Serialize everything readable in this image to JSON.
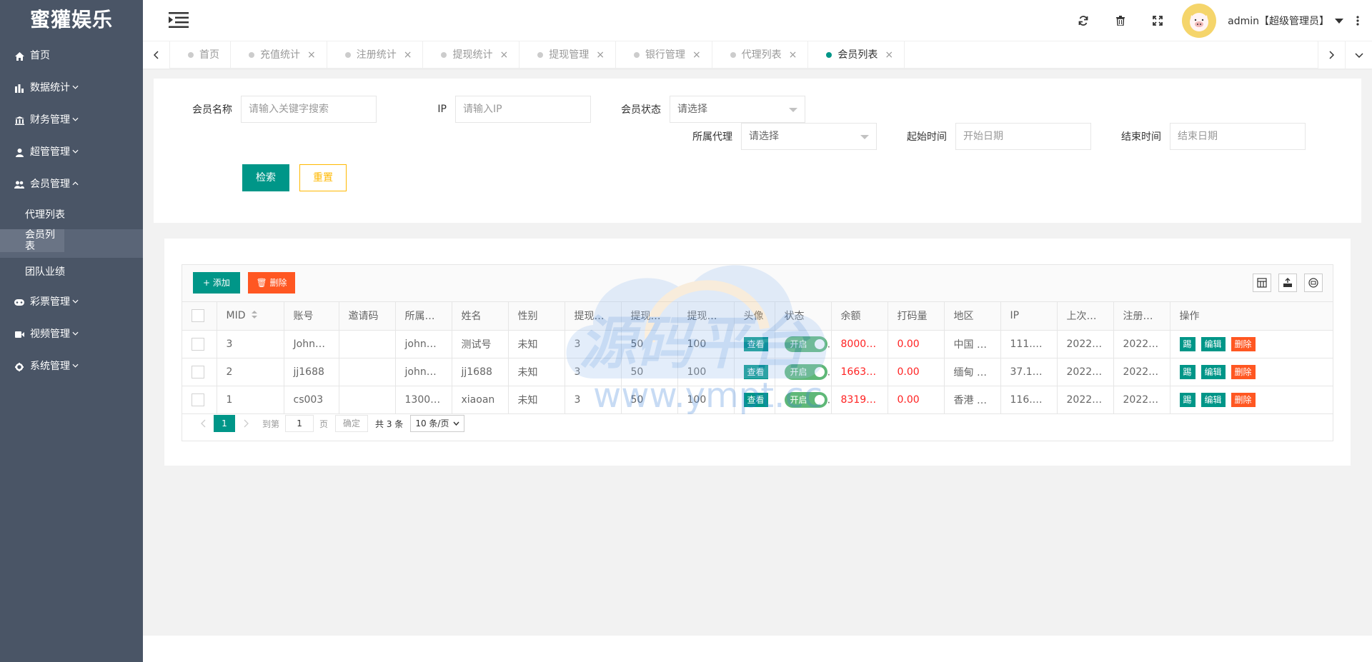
{
  "app": {
    "logo": "蜜獾娱乐"
  },
  "sidebar": {
    "items": [
      {
        "label": "首页",
        "icon": "home-icon"
      },
      {
        "label": "数据统计",
        "icon": "bar-chart-icon"
      },
      {
        "label": "财务管理",
        "icon": "bank-icon"
      },
      {
        "label": "超管管理",
        "icon": "user-icon"
      },
      {
        "label": "会员管理",
        "icon": "users-icon"
      },
      {
        "label": "彩票管理",
        "icon": "gamepad-icon"
      },
      {
        "label": "视频管理",
        "icon": "video-icon"
      },
      {
        "label": "系统管理",
        "icon": "gear-icon"
      }
    ],
    "member_sub": [
      "代理列表",
      "会员列表",
      "团队业绩"
    ]
  },
  "header": {
    "user": "admin【超级管理员】"
  },
  "tabs": [
    "首页",
    "充值统计",
    "注册统计",
    "提现统计",
    "提现管理",
    "银行管理",
    "代理列表",
    "会员列表"
  ],
  "search": {
    "member_name_label": "会员名称",
    "member_name_placeholder": "请输入关键字搜索",
    "ip_label": "IP",
    "ip_placeholder": "请输入IP",
    "status_label": "会员状态",
    "status_value": "请选择",
    "agent_label": "所属代理",
    "agent_value": "请选择",
    "start_label": "起始时间",
    "start_placeholder": "开始日期",
    "end_label": "结束时间",
    "end_placeholder": "结束日期",
    "search_btn": "检索",
    "reset_btn": "重置"
  },
  "toolbar": {
    "add": "添加",
    "delete": "删除"
  },
  "table": {
    "headers": [
      "MID",
      "账号",
      "邀请码",
      "所属…",
      "姓名",
      "性别",
      "提现…",
      "提现…",
      "提现…",
      "头像",
      "状态",
      "余额",
      "打码量",
      "地区",
      "IP",
      "上次…",
      "注册…",
      "操作"
    ],
    "rows": [
      {
        "mid": "3",
        "account": "John…",
        "invite": "",
        "agent": "john…",
        "name": "测试号",
        "gender": "未知",
        "w1": "3",
        "w2": "50",
        "w3": "100",
        "avatar_btn": "查看",
        "status": "开启",
        "balance": "8000…",
        "code": "0.00",
        "region": "中国 …",
        "ip": "111.2…",
        "last": "2022…",
        "reg": "2022…"
      },
      {
        "mid": "2",
        "account": "jj1688",
        "invite": "",
        "agent": "john…",
        "name": "jj1688",
        "gender": "未知",
        "w1": "3",
        "w2": "50",
        "w3": "100",
        "avatar_btn": "查看",
        "status": "开启",
        "balance": "1663…",
        "code": "0.00",
        "region": "缅甸 …",
        "ip": "37.11…",
        "last": "2022…",
        "reg": "2022…"
      },
      {
        "mid": "1",
        "account": "cs003",
        "invite": "",
        "agent": "1300…",
        "name": "xiaoan",
        "gender": "未知",
        "w1": "3",
        "w2": "50",
        "w3": "100",
        "avatar_btn": "查看",
        "status": "开启",
        "balance": "8319…",
        "code": "0.00",
        "region": "香港 …",
        "ip": "116.2…",
        "last": "2022…",
        "reg": "2022…"
      }
    ],
    "actions": {
      "login": "踢",
      "edit": "编辑",
      "delete": "删除"
    }
  },
  "pager": {
    "current": "1",
    "goto_label": "到第",
    "page_input": "1",
    "page_unit": "页",
    "confirm": "确定",
    "total": "共 3 条",
    "page_size": "10 条/页"
  },
  "watermark": {
    "main": "源码平台",
    "url": "www.ympt.cc"
  },
  "colors": {
    "sidebar": "#4a5566",
    "primary": "#009688",
    "danger": "#ff5722",
    "warn": "#ffb800",
    "switch": "#5fb878",
    "money": "#ff2222"
  }
}
